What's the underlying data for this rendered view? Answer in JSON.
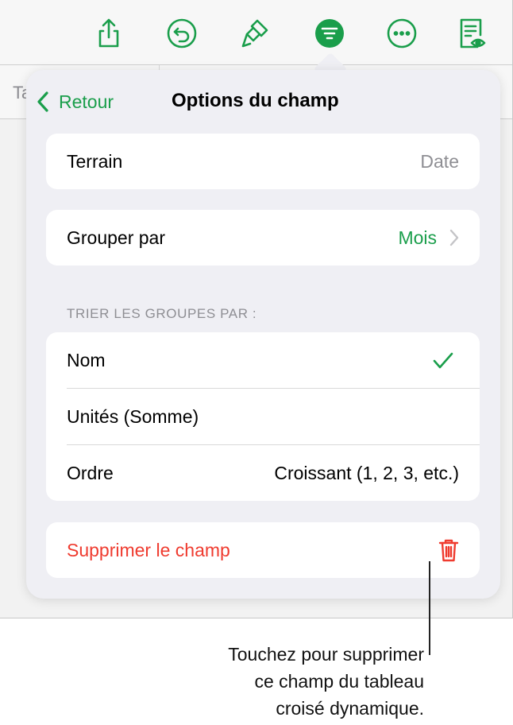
{
  "background": {
    "row_text": "Ta"
  },
  "toolbar": {
    "icons": [
      "share-icon",
      "undo-icon",
      "format-brush-icon",
      "organize-icon",
      "more-icon",
      "reading-view-icon"
    ]
  },
  "popover": {
    "back_label": "Retour",
    "title": "Options du champ"
  },
  "field": {
    "label": "Terrain",
    "value": "Date"
  },
  "group_by": {
    "label": "Grouper par",
    "value": "Mois"
  },
  "sort": {
    "header": "TRIER LES GROUPES PAR :",
    "options": [
      {
        "label": "Nom",
        "selected": true
      },
      {
        "label": "Unités (Somme)",
        "selected": false
      }
    ],
    "order_label": "Ordre",
    "order_value": "Croissant (1, 2, 3, etc.)"
  },
  "delete": {
    "label": "Supprimer le champ"
  },
  "callout": {
    "lines": [
      "Touchez pour supprimer",
      "ce champ du tableau",
      "croisé dynamique."
    ]
  },
  "colors": {
    "accent": "#1a9e4b",
    "destructive": "#ef3b2f",
    "secondary_text": "#8e8e93"
  }
}
